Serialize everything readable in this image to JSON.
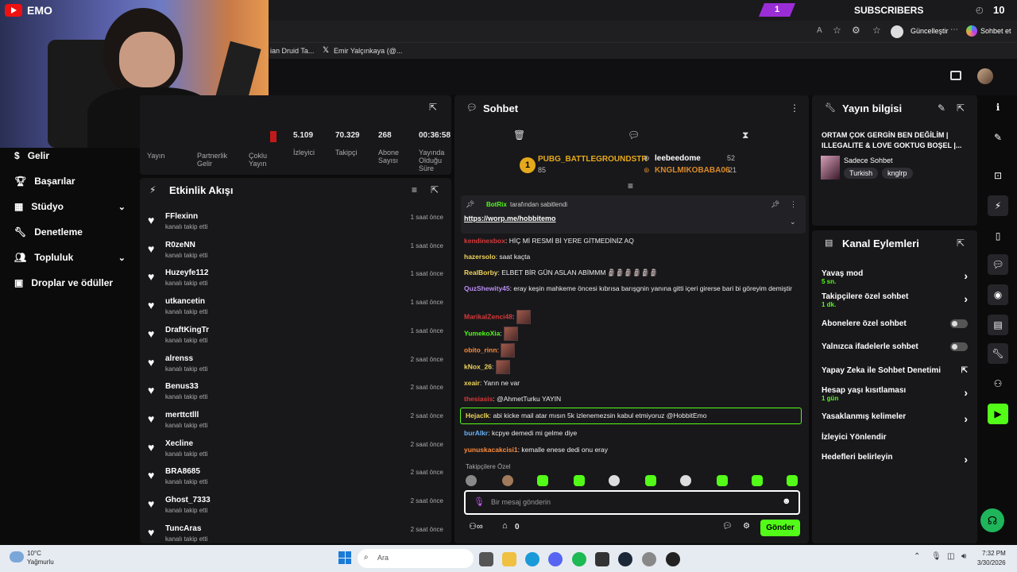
{
  "overlay": {
    "brand": "EMO",
    "subs_badge": "1",
    "subs_label": "SUBSCRIBERS",
    "subs_count": "10",
    "subs_timer": "◴"
  },
  "browser": {
    "update_label": "Güncelleştir",
    "profile_label": "Sohbet et",
    "bookmarks": [
      "ian Druid Ta...",
      "Emir Yalçınkaya (@..."
    ]
  },
  "stats": {
    "items": [
      {
        "value": "5.109",
        "label": "İzleyici"
      },
      {
        "value": "70.329",
        "label": "Takipçi"
      },
      {
        "value": "268",
        "label": "Abone Sayısı"
      },
      {
        "value": "00:36:58",
        "label": "Yayında Olduğu Süre"
      }
    ],
    "tabs": [
      "Yayın",
      "Partnerlik Gelir",
      "Çoklu Yayın"
    ]
  },
  "sidebar": {
    "items": [
      {
        "label": "Gelir",
        "icon": "dollar-icon"
      },
      {
        "label": "Başarılar",
        "icon": "trophy-icon"
      },
      {
        "label": "Stüdyo",
        "icon": "grid-icon",
        "chevron": true
      },
      {
        "label": "Denetleme",
        "icon": "wrench-icon"
      },
      {
        "label": "Topluluk",
        "icon": "people-icon",
        "chevron": true
      },
      {
        "label": "Droplar ve ödüller",
        "icon": "gift-icon"
      }
    ]
  },
  "activity": {
    "title": "Etkinlik Akışı",
    "events": [
      {
        "name": "FFlexinn",
        "action": "kanalı takip etti",
        "time": "1 saat önce"
      },
      {
        "name": "R0zeNN",
        "action": "kanalı takip etti",
        "time": "1 saat önce"
      },
      {
        "name": "Huzeyfe112",
        "action": "kanalı takip etti",
        "time": "1 saat önce"
      },
      {
        "name": "utkancetin",
        "action": "kanalı takip etti",
        "time": "1 saat önce"
      },
      {
        "name": "DraftKingTr",
        "action": "kanalı takip etti",
        "time": "1 saat önce"
      },
      {
        "name": "alrenss",
        "action": "kanalı takip etti",
        "time": "2 saat önce"
      },
      {
        "name": "Benus33",
        "action": "kanalı takip etti",
        "time": "2 saat önce"
      },
      {
        "name": "merttctlll",
        "action": "kanalı takip etti",
        "time": "2 saat önce"
      },
      {
        "name": "Xecline",
        "action": "kanalı takip etti",
        "time": "2 saat önce"
      },
      {
        "name": "BRA8685",
        "action": "kanalı takip etti",
        "time": "2 saat önce"
      },
      {
        "name": "Ghost_7333",
        "action": "kanalı takip etti",
        "time": "2 saat önce"
      },
      {
        "name": "TuncAras",
        "action": "kanalı takip etti",
        "time": "2 saat önce"
      }
    ]
  },
  "chat": {
    "title": "Sohbet",
    "leaderboard": {
      "first": {
        "name": "PUBG_BATTLEGROUNDSTR",
        "points": "85",
        "rank": "1"
      },
      "second": {
        "name": "leebeedome",
        "points": "52"
      },
      "third": {
        "name": "KNGLMIKOBABA06",
        "points": "21"
      }
    },
    "pinned": {
      "by": "BotRix",
      "by_suffix": "tarafından sabitlendi",
      "link": "https://worp.me/hobbitemo"
    },
    "messages": [
      {
        "user": "kendinexbox",
        "text": "HİÇ Mİ RESMİ Bİ YERE GİTMEDİNİZ AQ",
        "color": "#d63a3a"
      },
      {
        "user": "hazersolo",
        "text": "saat kaçta",
        "color": "#f0d45a"
      },
      {
        "user": "RealBorby",
        "text": "ELBET BİR GÜN ASLAN ABİMMM 🗿🗿🗿🗿🗿🗿",
        "color": "#f0d45a"
      },
      {
        "user": "QuzShewity45",
        "text": "eray keşin mahkeme öncesi kıbrısa barışgnin yanına gitti içeri girerse bari bi göreyim demiştir",
        "color": "#b98cf0"
      },
      {
        "user": "MarikalZenci48",
        "text": "",
        "color": "#d63a3a",
        "emote": true
      },
      {
        "user": "YumekoXia",
        "text": "",
        "color": "#53fc18",
        "emote": true
      },
      {
        "user": "obito_rinn",
        "text": "",
        "color": "#ff8c3a",
        "emote": true
      },
      {
        "user": "kNox_26",
        "text": "",
        "color": "#f0d45a",
        "emote": true
      },
      {
        "user": "xeair",
        "text": "Yarın ne var",
        "color": "#f0d45a"
      },
      {
        "user": "thesiasis",
        "text": "@AhmetTurku YAYIN",
        "color": "#d63a3a"
      },
      {
        "user": "Hejaclk",
        "text": "abi kicke mail atar mısın 5k izlenemezsin kabul etmiyoruz @HobbitEmo",
        "color": "#f0d45a",
        "highlight": true
      },
      {
        "user": "burAlkr",
        "text": "kcpye demedi mi gelme diye",
        "color": "#6ab0f5"
      },
      {
        "user": "yunuskacakcisi1",
        "text": "kemalle enese dedi onu eray",
        "color": "#ff8c3a"
      }
    ],
    "followers_only": "Takipçilere Özel",
    "input_placeholder": "Bir mesaj gönderin",
    "points": "0",
    "send_label": "Gönder"
  },
  "stream_info": {
    "title": "Yayın bilgisi",
    "stream_title": "ORTAM ÇOK GERGİN BEN DEĞİLİM | ILLEGALITE & LOVE GOKTUG BOŞEL |...",
    "category": "Sadece Sohbet",
    "tags": [
      "Turkish",
      "knglrp"
    ]
  },
  "channel_actions": {
    "title": "Kanal Eylemleri",
    "items": [
      {
        "label": "Yavaş mod",
        "sub": "5 sn.",
        "control": "chevron"
      },
      {
        "label": "Takipçilere özel sohbet",
        "sub": "1 dk.",
        "control": "chevron"
      },
      {
        "label": "Abonelere özel sohbet",
        "sub": "",
        "control": "toggle"
      },
      {
        "label": "Yalnızca ifadelerle sohbet",
        "sub": "",
        "control": "toggle"
      },
      {
        "label": "Yapay Zeka ile Sohbet Denetimi",
        "sub": "",
        "control": "external"
      },
      {
        "label": "Hesap yaşı kısıtlaması",
        "sub": "1 gün",
        "control": "chevron"
      },
      {
        "label": "Yasaklanmış kelimeler",
        "sub": "",
        "control": "chevron"
      },
      {
        "label": "İzleyici Yönlendir",
        "sub": "",
        "control": "none"
      },
      {
        "label": "Hedefleri belirleyin",
        "sub": "",
        "control": "chevron"
      }
    ]
  },
  "taskbar": {
    "weather_temp": "10°C",
    "weather_desc": "Yağmurlu",
    "search_placeholder": "Ara",
    "time": "7:32 PM",
    "date": "3/30/2026"
  },
  "colors": {
    "accent": "#53fc18",
    "panel": "#18181b",
    "background": "#0b0b0c"
  }
}
